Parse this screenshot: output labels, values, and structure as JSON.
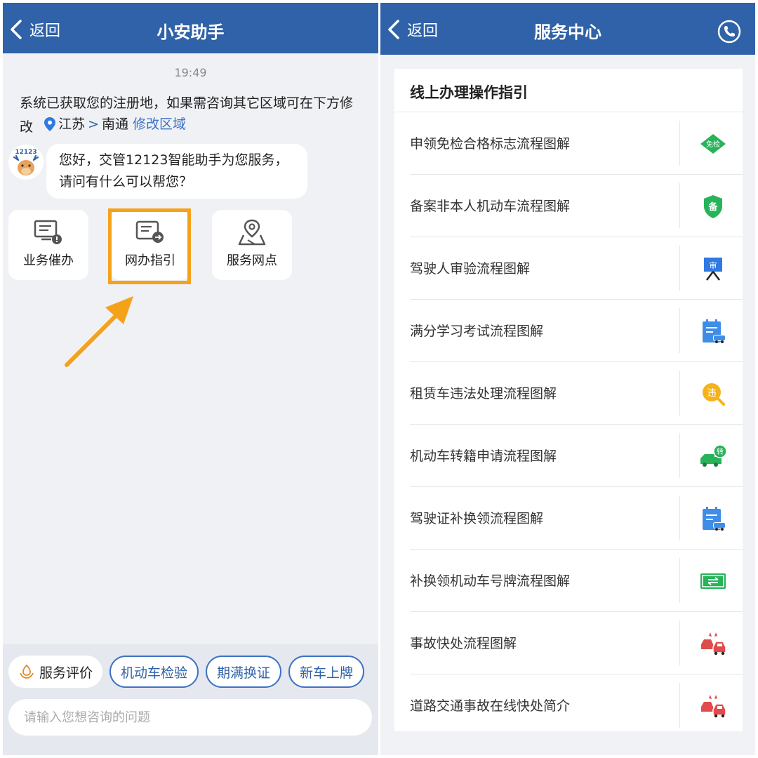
{
  "left": {
    "nav": {
      "back_label": "返回",
      "title": "小安助手"
    },
    "timestamp": "19:49",
    "system_message": {
      "text": "系统已获取您的注册地，如果需咨询其它区域可在下方修改",
      "province": "江苏",
      "chevron": ">",
      "city": "南通",
      "modify_link": "修改区域"
    },
    "avatar_text": "12123",
    "bubble": {
      "line1": "您好，交管12123智能助手为您服务，",
      "line2": "请问有什么可以帮您？"
    },
    "quick_actions": [
      {
        "label": "业务催办",
        "icon": "monitor-alert-icon"
      },
      {
        "label": "网办指引",
        "icon": "document-arrow-icon"
      },
      {
        "label": "服务网点",
        "icon": "map-pin-icon"
      }
    ],
    "chips": {
      "rating": "服务评价",
      "topics": [
        "机动车检验",
        "期满换证",
        "新车上牌"
      ]
    },
    "input_placeholder": "请输入您想咨询的问题"
  },
  "right": {
    "nav": {
      "back_label": "返回",
      "title": "服务中心"
    },
    "card_title": "线上办理操作指引",
    "items": [
      {
        "label": "申领免检合格标志流程图解",
        "icon": "exemption-diamond-icon",
        "icon_text": "免检"
      },
      {
        "label": "备案非本人机动车流程图解",
        "icon": "shield-record-icon",
        "icon_text": "备"
      },
      {
        "label": "驾驶人审验流程图解",
        "icon": "review-board-icon",
        "icon_text": "审"
      },
      {
        "label": "满分学习考试流程图解",
        "icon": "calendar-car-icon"
      },
      {
        "label": "租赁车违法处理流程图解",
        "icon": "violation-search-icon",
        "icon_text": "违"
      },
      {
        "label": "机动车转籍申请流程图解",
        "icon": "transfer-truck-icon",
        "icon_text": "转"
      },
      {
        "label": "驾驶证补换领流程图解",
        "icon": "calendar-car-icon"
      },
      {
        "label": "补换领机动车号牌流程图解",
        "icon": "license-plate-icon"
      },
      {
        "label": "事故快处流程图解",
        "icon": "accident-cars-icon"
      },
      {
        "label": "道路交通事故在线快处简介",
        "icon": "accident-cars-icon"
      }
    ]
  },
  "colors": {
    "nav_blue": "#2f62a8",
    "highlight_orange": "#f5a21b",
    "link_blue": "#3d72c4",
    "green": "#27b35a",
    "red": "#e04b4b",
    "yellow": "#f6b21a"
  }
}
